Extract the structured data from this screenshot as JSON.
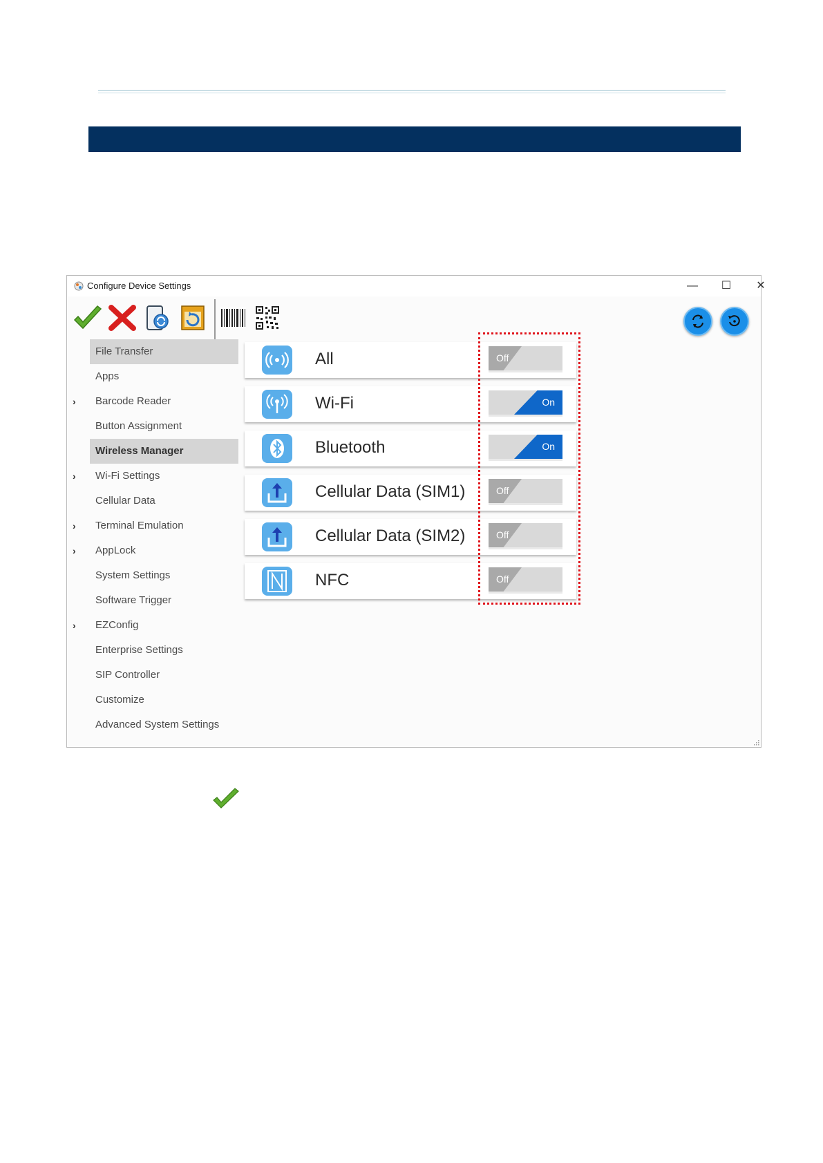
{
  "window": {
    "title": "Configure Device Settings",
    "controls": {
      "minimize": "—",
      "maximize": "☐",
      "close": "✕"
    }
  },
  "toolbar": {
    "buttons": [
      {
        "name": "apply-check-icon"
      },
      {
        "name": "cancel-x-icon"
      },
      {
        "name": "device-sync-icon"
      },
      {
        "name": "restore-icon"
      },
      {
        "name": "barcode-icon"
      },
      {
        "name": "qr-code-icon"
      }
    ],
    "right_buttons": [
      {
        "name": "sync-icon"
      },
      {
        "name": "reset-icon"
      }
    ]
  },
  "sidebar": {
    "items": [
      {
        "label": "File Transfer",
        "selected": true,
        "chevron": false
      },
      {
        "label": "Apps",
        "selected": false,
        "chevron": false
      },
      {
        "label": "Barcode Reader",
        "selected": false,
        "chevron": true
      },
      {
        "label": "Button Assignment",
        "selected": false,
        "chevron": false
      },
      {
        "label": "Wireless Manager",
        "selected": true,
        "chevron": false
      },
      {
        "label": "Wi-Fi Settings",
        "selected": false,
        "chevron": true
      },
      {
        "label": "Cellular Data",
        "selected": false,
        "chevron": false
      },
      {
        "label": "Terminal Emulation",
        "selected": false,
        "chevron": true
      },
      {
        "label": "AppLock",
        "selected": false,
        "chevron": true
      },
      {
        "label": "System Settings",
        "selected": false,
        "chevron": false
      },
      {
        "label": "Software Trigger",
        "selected": false,
        "chevron": false
      },
      {
        "label": "EZConfig",
        "selected": false,
        "chevron": true
      },
      {
        "label": "Enterprise Settings",
        "selected": false,
        "chevron": false
      },
      {
        "label": "SIP Controller",
        "selected": false,
        "chevron": false
      },
      {
        "label": "Customize",
        "selected": false,
        "chevron": false
      },
      {
        "label": "Advanced System Settings",
        "selected": false,
        "chevron": false
      }
    ]
  },
  "wireless": {
    "items": [
      {
        "label": "All",
        "icon": "broadcast-icon",
        "state": "Off"
      },
      {
        "label": "Wi-Fi",
        "icon": "antenna-icon",
        "state": "On"
      },
      {
        "label": "Bluetooth",
        "icon": "bluetooth-icon",
        "state": "On"
      },
      {
        "label": "Cellular Data (SIM1)",
        "icon": "upload-icon",
        "state": "Off"
      },
      {
        "label": "Cellular Data (SIM2)",
        "icon": "upload-icon",
        "state": "Off"
      },
      {
        "label": "NFC",
        "icon": "nfc-icon",
        "state": "Off"
      }
    ]
  },
  "colors": {
    "banner": "#04305f",
    "toggle_on": "#0f67c9",
    "toggle_off": "#a9a9a9",
    "highlight": "#e0141b",
    "card_icon": "#5aaeea"
  }
}
